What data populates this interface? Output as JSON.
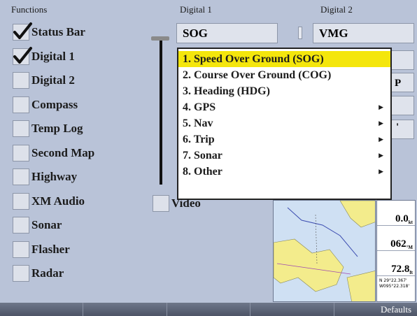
{
  "headers": {
    "functions": "Functions",
    "digital1": "Digital 1",
    "digital2": "Digital 2"
  },
  "functions": [
    {
      "label": "Status Bar",
      "checked": true
    },
    {
      "label": "Digital 1",
      "checked": true
    },
    {
      "label": "Digital 2",
      "checked": false
    },
    {
      "label": "Compass",
      "checked": false
    },
    {
      "label": "Temp Log",
      "checked": false
    },
    {
      "label": "Second Map",
      "checked": false
    },
    {
      "label": "Highway",
      "checked": false
    },
    {
      "label": "XM Audio",
      "checked": false
    },
    {
      "label": "Sonar",
      "checked": false
    },
    {
      "label": "Flasher",
      "checked": false
    },
    {
      "label": "Radar",
      "checked": false
    }
  ],
  "video": {
    "label": "Video",
    "checked": false
  },
  "digital1_field": "SOG",
  "digital2_field": "VMG",
  "partial_fields": [
    "P",
    "'"
  ],
  "popup_menu": [
    {
      "label": "1. Speed Over Ground (SOG)",
      "selected": true,
      "submenu": false
    },
    {
      "label": "2. Course Over Ground (COG)",
      "selected": false,
      "submenu": false
    },
    {
      "label": "3. Heading (HDG)",
      "selected": false,
      "submenu": false
    },
    {
      "label": "4. GPS",
      "selected": false,
      "submenu": true
    },
    {
      "label": "5. Nav",
      "selected": false,
      "submenu": true
    },
    {
      "label": "6. Trip",
      "selected": false,
      "submenu": true
    },
    {
      "label": "7. Sonar",
      "selected": false,
      "submenu": true
    },
    {
      "label": "8. Other",
      "selected": false,
      "submenu": true
    }
  ],
  "preview_numbers": [
    {
      "value": "0.0",
      "unit": "kt"
    },
    {
      "value": "062",
      "unit": "°M"
    },
    {
      "value": "72.8",
      "unit": "ft"
    }
  ],
  "preview_coord": [
    "N 29°22.367'",
    "W095°22.318'"
  ],
  "softkeys": [
    "",
    "",
    "",
    "",
    "Defaults"
  ],
  "colors": {
    "background": "#b9c3d8",
    "highlight": "#f4e60c",
    "field": "#dfe3ec"
  },
  "icons": {
    "check": "checkmark-icon",
    "submenu": "triangle-right-icon"
  }
}
